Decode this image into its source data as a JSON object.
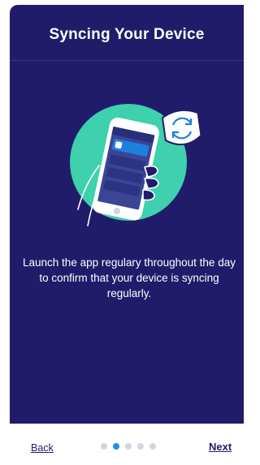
{
  "screen": {
    "title": "Syncing Your Device",
    "description": "Launch the app regulary throughout the day to confirm that your device is syncing regularly."
  },
  "illustration": {
    "icon": "phone-in-hand-with-sync-icon",
    "colors": {
      "circle": "#3fd0ad",
      "phone_screen": "#3b4596",
      "highlight_bar": "#1e7fe0",
      "outline": "#ffffff"
    }
  },
  "footer": {
    "back_label": "Back",
    "next_label": "Next",
    "pagination": {
      "total": 5,
      "current": 2
    }
  },
  "theme": {
    "primary": "#211c6a",
    "accent": "#1e90e6",
    "dot_inactive": "#d4d4de"
  }
}
